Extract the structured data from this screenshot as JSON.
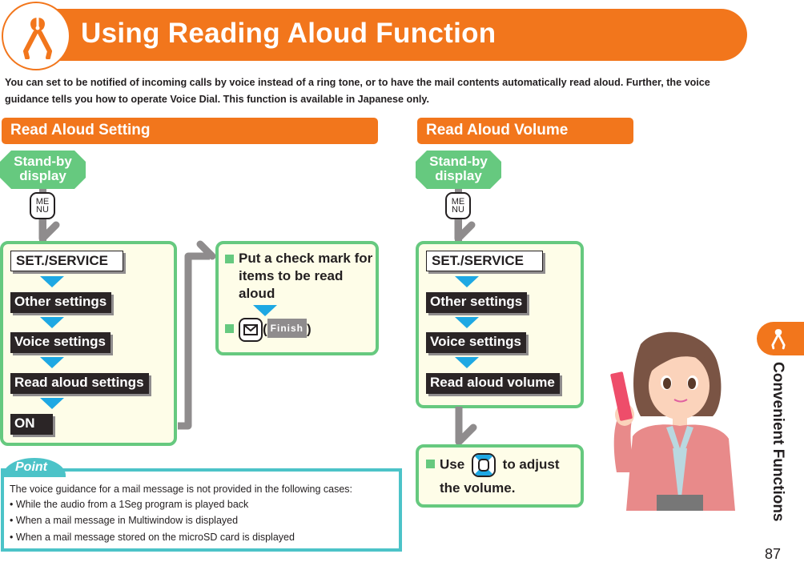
{
  "title": "Using Reading Aloud Function",
  "title_icon": "pliers-icon",
  "intro": "You can set to be notified of incoming calls by voice instead of a ring tone, or to have the mail contents automatically read aloud. Further, the voice guidance tells you how to operate Voice Dial. This function is available in Japanese only.",
  "colors": {
    "accent_orange": "#f2761c",
    "panel_green": "#66c97f",
    "arrow_blue": "#1ea8e3",
    "point_teal": "#4cc3c8",
    "panel_bg": "#fefde8"
  },
  "read_aloud_setting": {
    "header": "Read Aloud Setting",
    "start": "Stand-by display",
    "menu_key": {
      "line1": "ME",
      "line2": "NU"
    },
    "steps": [
      "SET./SERVICE",
      "Other settings",
      "Voice settings",
      "Read aloud settings",
      "ON"
    ],
    "next": {
      "step1": "Put a check mark for items to be read aloud",
      "step2_key": "mail-key",
      "step2_open": "(",
      "step2_softkey": "Finish",
      "step2_close": ")"
    }
  },
  "read_aloud_volume": {
    "header": "Read Aloud Volume",
    "start": "Stand-by display",
    "menu_key": {
      "line1": "ME",
      "line2": "NU"
    },
    "steps": [
      "SET./SERVICE",
      "Other settings",
      "Voice settings",
      "Read aloud volume"
    ],
    "final": {
      "before": "Use",
      "key": "navigation-key-up-down",
      "after": "to adjust",
      "line2": "the volume."
    }
  },
  "point": {
    "label": "Point",
    "intro": "The voice guidance for a mail message is not provided in the following cases:",
    "items": [
      "While the audio from a 1Seg program is played back",
      "When a mail message in Multiwindow is displayed",
      "When a mail message stored on the microSD card is displayed"
    ]
  },
  "side_tab": {
    "label": "Convenient Functions",
    "icon": "pliers-icon"
  },
  "page_number": "87"
}
